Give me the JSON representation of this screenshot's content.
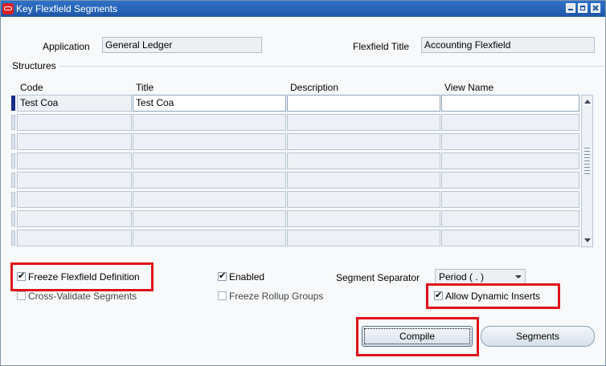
{
  "window": {
    "title": "Key Flexfield Segments"
  },
  "header": {
    "application_label": "Application",
    "application_value": "General Ledger",
    "flexfield_title_label": "Flexfield Title",
    "flexfield_title_value": "Accounting Flexfield"
  },
  "structures": {
    "section_label": "Structures",
    "columns": [
      "Code",
      "Title",
      "Description",
      "View Name"
    ],
    "rows": [
      [
        "Test Coa",
        "Test Coa",
        "",
        ""
      ],
      [
        "",
        "",
        "",
        ""
      ],
      [
        "",
        "",
        "",
        ""
      ],
      [
        "",
        "",
        "",
        ""
      ],
      [
        "",
        "",
        "",
        ""
      ],
      [
        "",
        "",
        "",
        ""
      ],
      [
        "",
        "",
        "",
        ""
      ],
      [
        "",
        "",
        "",
        ""
      ]
    ]
  },
  "options": {
    "freeze_flexfield_definition": {
      "label": "Freeze Flexfield Definition",
      "checked": true
    },
    "cross_validate_segments": {
      "label": "Cross-Validate Segments",
      "checked": false
    },
    "enabled": {
      "label": "Enabled",
      "checked": true
    },
    "freeze_rollup_groups": {
      "label": "Freeze Rollup Groups",
      "checked": false
    },
    "segment_separator_label": "Segment Separator",
    "segment_separator_value": "Period ( . )",
    "allow_dynamic_inserts": {
      "label": "Allow Dynamic Inserts",
      "checked": true
    }
  },
  "buttons": {
    "compile": "Compile",
    "segments": "Segments"
  },
  "highlight_color": "#e0101a",
  "titlebar_color": "#2f72c8"
}
